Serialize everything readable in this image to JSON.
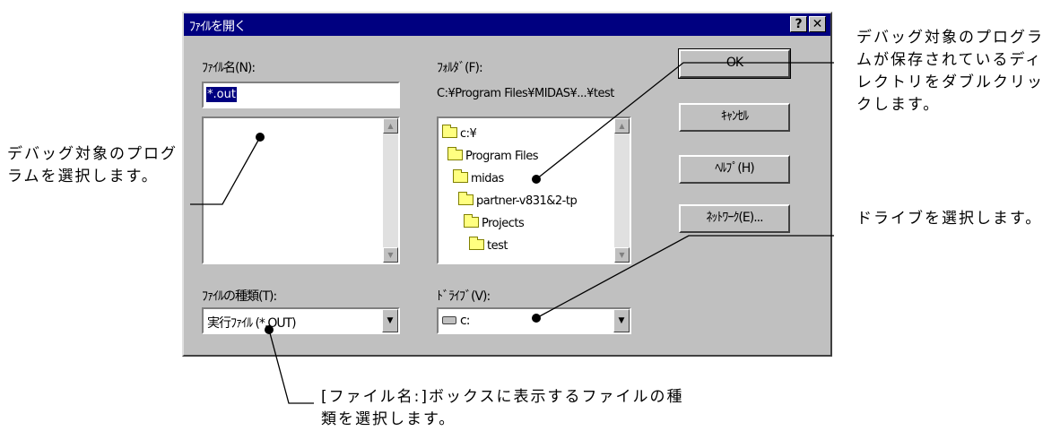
{
  "dialog": {
    "title": "ﾌｧｲﾙを開く",
    "help_glyph": "?",
    "close_glyph": "✕",
    "filename_label": "ﾌｧｲﾙ名(N):",
    "filename_value": "*.out",
    "folder_label": "ﾌｫﾙﾀﾞ(F):",
    "folder_path": "C:¥Program Files¥MIDAS¥...¥test",
    "filetype_label": "ﾌｧｲﾙの種類(T):",
    "filetype_value": "実行ﾌｧｲﾙ (*.OUT)",
    "drive_label": "ﾄﾞﾗｲﾌﾞ(V):",
    "drive_value": "c:",
    "folders": [
      "c:¥",
      "Program Files",
      "midas",
      "partner-v831&2-tp",
      "Projects",
      "test"
    ],
    "buttons": {
      "ok": "OK",
      "cancel": "ｷｬﾝｾﾙ",
      "help": "ﾍﾙﾌﾟ(H)",
      "network": "ﾈｯﾄﾜｰｸ(E)..."
    }
  },
  "callouts": {
    "left": "デバッグ対象のプログラムを選択します。",
    "right_top": "デバッグ対象のプログラムが保存されているディレクトリをダブルクリックします。",
    "right_mid": "ドライブを選択します。",
    "bottom": "[ファイル名:]ボックスに表示するファイルの種類を選択します。"
  },
  "colors": {
    "titlebar": "#000080",
    "dialog_face": "#c0c0c0",
    "selection": "#000080"
  }
}
